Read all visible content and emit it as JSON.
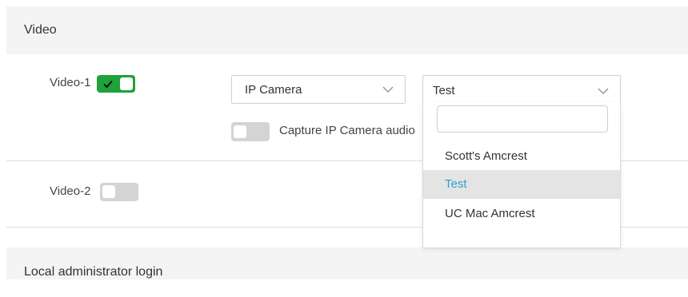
{
  "sections": {
    "video_title": "Video",
    "admin_title": "Local administrator login"
  },
  "video1": {
    "label": "Video-1",
    "enabled": true,
    "source_select": {
      "value": "IP Camera"
    },
    "camera_select": {
      "value": "Test"
    },
    "capture_audio": {
      "label": "Capture IP Camera audio",
      "enabled": false
    },
    "dropdown": {
      "search_value": "",
      "options": [
        "Scott's Amcrest",
        "Test",
        "UC Mac Amcrest"
      ],
      "selected": "Test"
    }
  },
  "video2": {
    "label": "Video-2",
    "enabled": false
  },
  "colors": {
    "toggle_on": "#1ea33a",
    "toggle_off": "#d4d4d4",
    "selected_text": "#2a9fd6",
    "selected_bg": "#e4e4e4"
  },
  "icons": {
    "toggle_on": "check-icon",
    "select_arrow": "chevron-down-icon"
  }
}
